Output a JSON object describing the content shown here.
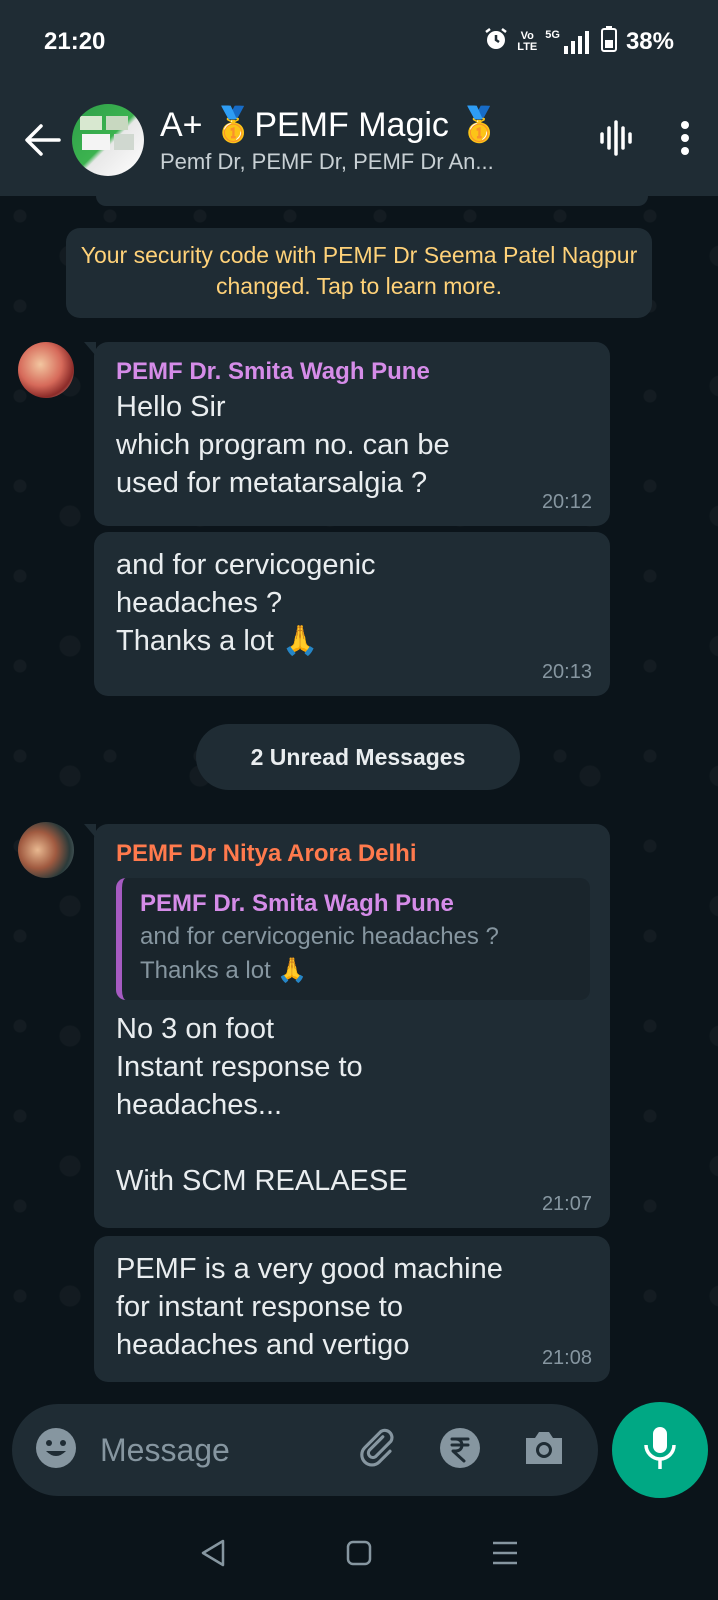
{
  "status_bar": {
    "time": "21:20",
    "network_top": "Vo",
    "network_bottom": "LTE",
    "signal_label": "5G",
    "battery": "38%"
  },
  "header": {
    "title": "A+ 🥇PEMF Magic 🥇",
    "subtitle": "Pemf Dr, PEMF Dr, PEMF Dr An..."
  },
  "system_message": "Your security code with PEMF Dr Seema Patel Nagpur changed. Tap to learn more.",
  "messages": [
    {
      "sender": "PEMF Dr. Smita Wagh Pune",
      "text": "Hello Sir\nwhich program no. can  be\nused for metatarsalgia ?",
      "time": "20:12"
    },
    {
      "text": "and for cervicogenic\nheadaches ?\nThanks a lot 🙏",
      "time": "20:13"
    },
    {
      "sender": "PEMF Dr Nitya Arora Delhi",
      "quote_sender": "PEMF Dr. Smita Wagh Pune",
      "quote_text": "and for cervicogenic headaches ?\nThanks a lot 🙏",
      "text": "No 3 on foot\nInstant response to\nheadaches...\n\nWith SCM REALAESE",
      "time": "21:07"
    },
    {
      "text": "PEMF is a very good machine\nfor instant response to\nheadaches and vertigo",
      "time": "21:08"
    }
  ],
  "unread_label": "2 Unread Messages",
  "input": {
    "placeholder": "Message"
  },
  "colors": {
    "accent": "#00a884",
    "sender_purple": "#d58ce8",
    "sender_orange": "#ff7a4d",
    "system_yellow": "#ffd279"
  }
}
